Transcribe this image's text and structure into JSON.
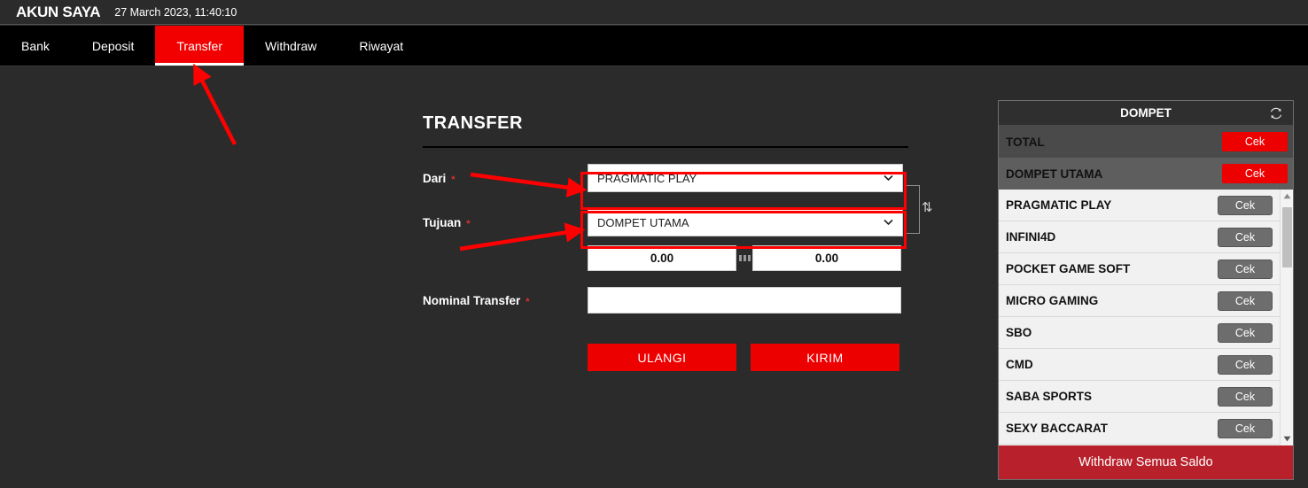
{
  "topbar": {
    "brand": "AKUN SAYA",
    "datetime": "27 March 2023, 11:40:10"
  },
  "nav": {
    "tabs": [
      {
        "label": "Bank",
        "active": false
      },
      {
        "label": "Deposit",
        "active": false
      },
      {
        "label": "Transfer",
        "active": true
      },
      {
        "label": "Withdraw",
        "active": false
      },
      {
        "label": "Riwayat",
        "active": false
      }
    ]
  },
  "form": {
    "title": "TRANSFER",
    "from_label": "Dari",
    "from_value": "PRAGMATIC PLAY",
    "to_label": "Tujuan",
    "to_value": "DOMPET UTAMA",
    "required_mark": "*",
    "balance_from": "0.00",
    "balance_to": "0.00",
    "nominal_label": "Nominal Transfer",
    "nominal_value": "",
    "nominal_placeholder": "",
    "reset_button": "ULANGI",
    "submit_button": "KIRIM",
    "swap_icon": "swap-vertical-icon"
  },
  "wallet": {
    "title": "DOMPET",
    "refresh_icon": "refresh-icon",
    "summary_rows": [
      {
        "name": "TOTAL",
        "button": "Cek",
        "style": "dark-a"
      },
      {
        "name": "DOMPET UTAMA",
        "button": "Cek",
        "style": "dark-b"
      }
    ],
    "items": [
      {
        "name": "PRAGMATIC PLAY",
        "button": "Cek"
      },
      {
        "name": "INFINI4D",
        "button": "Cek"
      },
      {
        "name": "POCKET GAME SOFT",
        "button": "Cek"
      },
      {
        "name": "MICRO GAMING",
        "button": "Cek"
      },
      {
        "name": "SBO",
        "button": "Cek"
      },
      {
        "name": "CMD",
        "button": "Cek"
      },
      {
        "name": "SABA SPORTS",
        "button": "Cek"
      },
      {
        "name": "SEXY BACCARAT",
        "button": "Cek"
      }
    ],
    "footer_button": "Withdraw Semua Saldo"
  },
  "colors": {
    "accent_red": "#ed0000",
    "tab_red": "#f20000",
    "dark_red": "#b8202b",
    "page_bg": "#2b2b2b",
    "nav_bg": "#000000",
    "annotation_red": "#ff0000"
  },
  "annotations": {
    "arrow_to_transfer_tab": "red-arrow",
    "arrow_to_from_select": "red-arrow",
    "arrow_to_to_select": "red-arrow",
    "highlight_from_select": "red-box",
    "highlight_to_select": "red-box"
  }
}
